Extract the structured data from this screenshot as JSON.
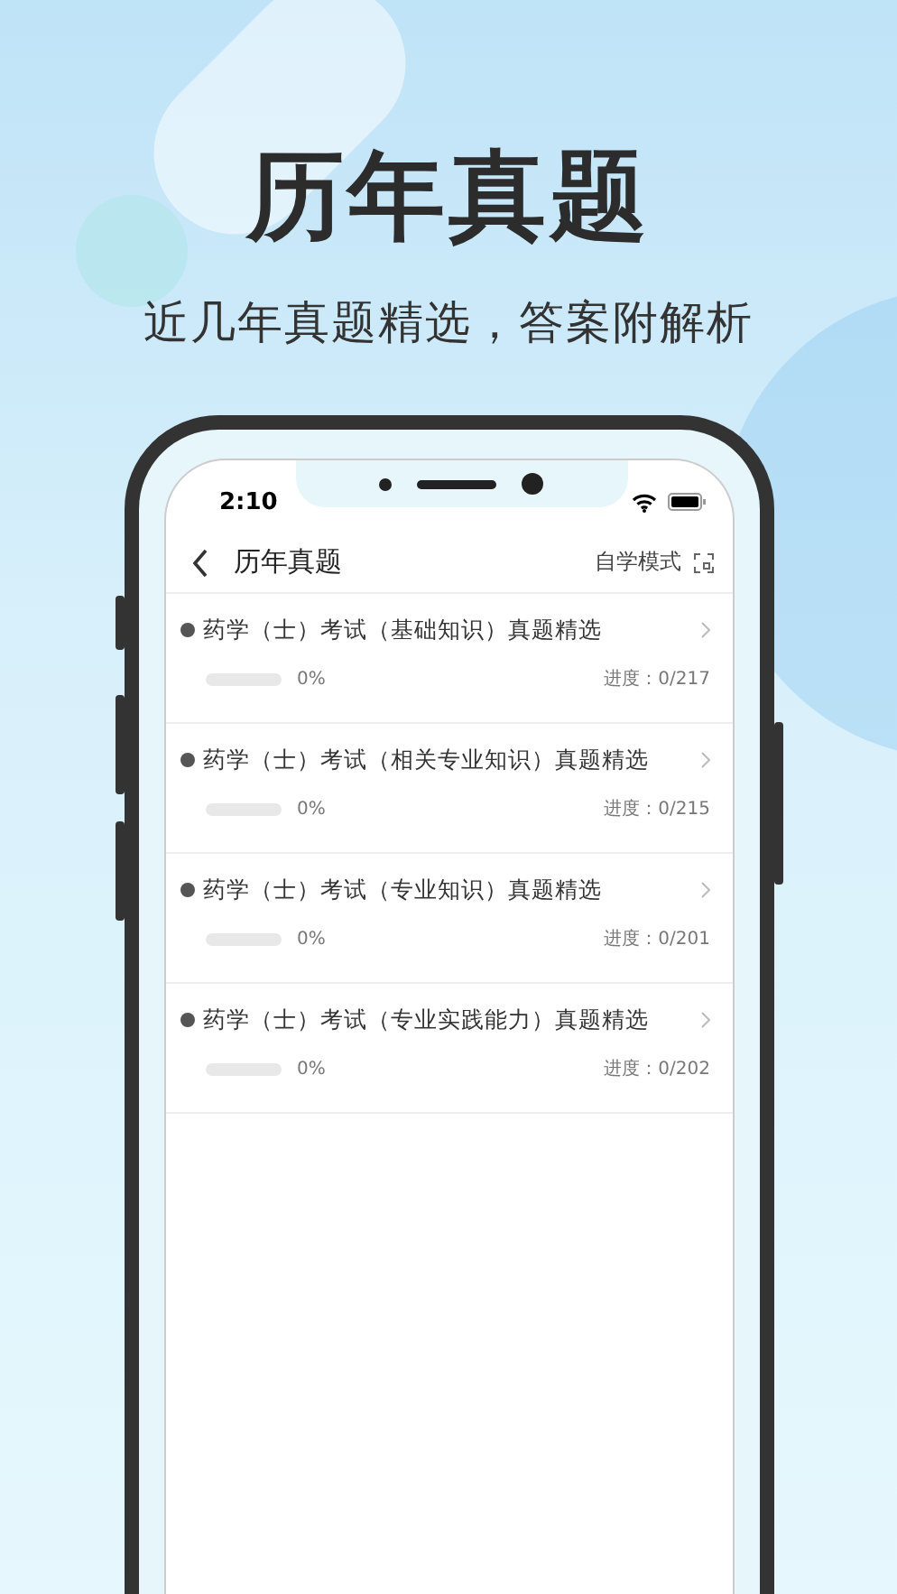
{
  "headline": "历年真题",
  "subtitle": "近几年真题精选，答案附解析",
  "status_bar": {
    "time": "2:10"
  },
  "nav": {
    "title": "历年真题",
    "mode_label": "自学模式"
  },
  "items": [
    {
      "title": "药学（士）考试（基础知识）真题精选",
      "level": 0,
      "percent": "0%",
      "progress": "进度：0/217"
    },
    {
      "title": "药学（士）考试（相关专业知识）真题精选",
      "level": 0,
      "percent": "0%",
      "progress": "进度：0/215"
    },
    {
      "title": "药学（士）考试（专业知识）真题精选",
      "level": 0,
      "percent": "0%",
      "progress": "进度：0/201"
    },
    {
      "title": "药学（士）考试（专业实践能力）真题精选",
      "level": 0,
      "percent": "0%",
      "progress": "进度：0/202"
    }
  ]
}
